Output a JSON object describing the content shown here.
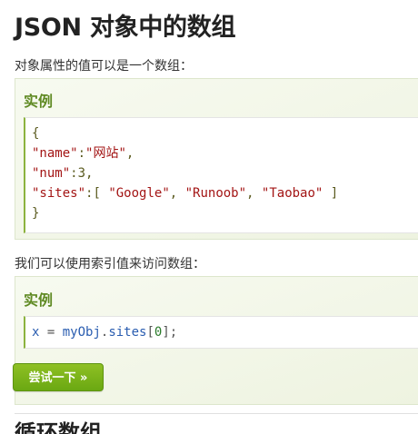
{
  "page": {
    "title": "JSON 对象中的数组",
    "intro_1": "对象属性的值可以是一个数组：",
    "intro_2": "我们可以使用索引值来访问数组：",
    "next_heading": "循环数组"
  },
  "example_1": {
    "heading": "实例",
    "lines": [
      [
        {
          "t": "{",
          "c": "punc"
        }
      ],
      [
        {
          "t": "\"name\"",
          "c": "str"
        },
        {
          "t": ":",
          "c": "punc"
        },
        {
          "t": "\"网站\"",
          "c": "str"
        },
        {
          "t": ",",
          "c": "punc"
        }
      ],
      [
        {
          "t": "\"num\"",
          "c": "str"
        },
        {
          "t": ":3,",
          "c": "punc"
        }
      ],
      [
        {
          "t": "\"sites\"",
          "c": "str"
        },
        {
          "t": ":[ ",
          "c": "punc"
        },
        {
          "t": "\"Google\"",
          "c": "str"
        },
        {
          "t": ", ",
          "c": "punc"
        },
        {
          "t": "\"Runoob\"",
          "c": "str"
        },
        {
          "t": ", ",
          "c": "punc"
        },
        {
          "t": "\"Taobao\"",
          "c": "str"
        },
        {
          "t": " ]",
          "c": "punc"
        }
      ],
      [
        {
          "t": "}",
          "c": "punc"
        }
      ]
    ]
  },
  "example_2": {
    "heading": "实例",
    "lines": [
      [
        {
          "t": "x",
          "c": "var"
        },
        {
          "t": " = ",
          "c": "op"
        },
        {
          "t": "myObj",
          "c": "var"
        },
        {
          "t": ".",
          "c": "op"
        },
        {
          "t": "sites",
          "c": "var"
        },
        {
          "t": "[",
          "c": "op"
        },
        {
          "t": "0",
          "c": "num"
        },
        {
          "t": "];",
          "c": "op"
        }
      ]
    ],
    "button_label": "尝试一下 »"
  }
}
